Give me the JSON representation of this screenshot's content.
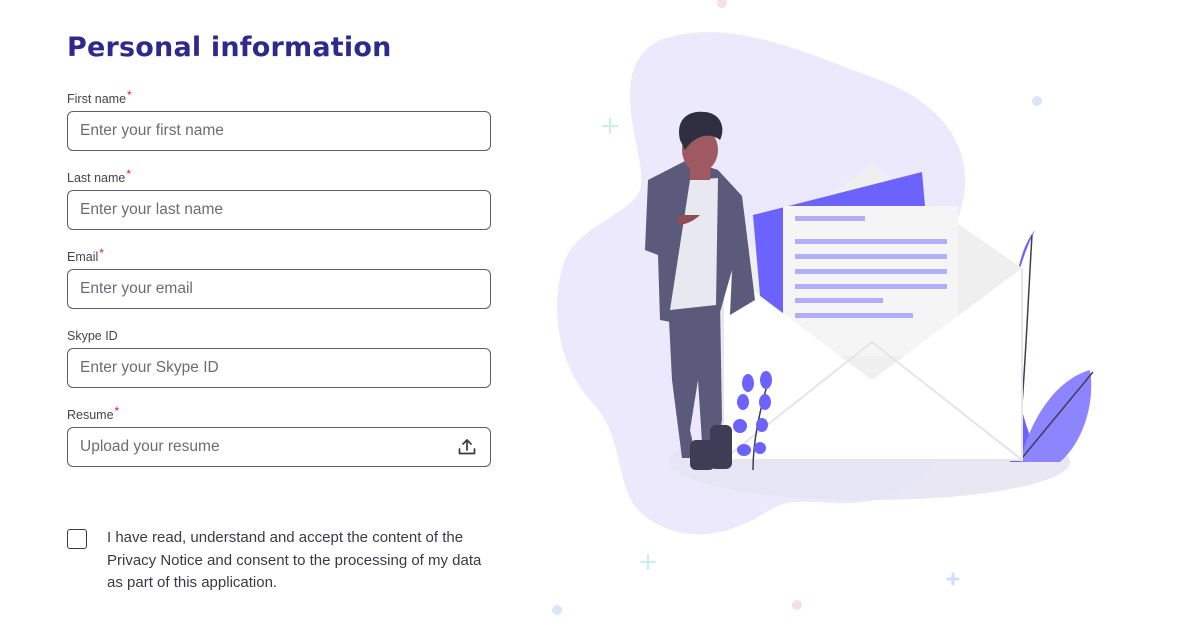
{
  "page": {
    "title": "Personal information"
  },
  "form": {
    "fields": [
      {
        "label": "First name",
        "required": "*",
        "placeholder": "Enter your first name"
      },
      {
        "label": "Last name",
        "required": "*",
        "placeholder": "Enter your last name"
      },
      {
        "label": "Email",
        "required": "*",
        "placeholder": "Enter your email"
      },
      {
        "label": "Skype ID",
        "required": "",
        "placeholder": "Enter your Skype ID"
      }
    ],
    "resume": {
      "label": "Resume",
      "required": "*",
      "placeholder": "Upload your resume",
      "icon": "upload-icon"
    },
    "consent": {
      "checked": false,
      "text": "I have read, understand and accept the content of the Privacy Notice and consent to the processing of my data as part of this application."
    }
  },
  "colors": {
    "title": "#2e2a8c",
    "required": "#e8184a",
    "accent": "#6c63ff",
    "blob": "#ebe9fb"
  }
}
